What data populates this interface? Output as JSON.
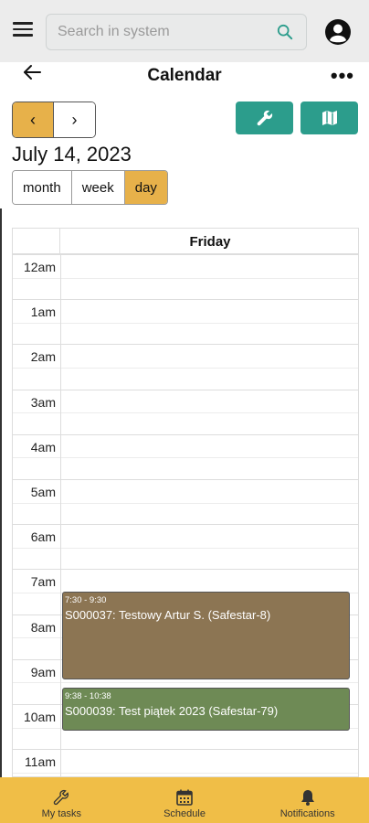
{
  "search": {
    "placeholder": "Search in system"
  },
  "page": {
    "title": "Calendar",
    "more_label": "•••"
  },
  "nav": {
    "prev_label": "‹",
    "next_label": "›"
  },
  "date_title": "July 14, 2023",
  "views": [
    {
      "label": "month",
      "active": false
    },
    {
      "label": "week",
      "active": false
    },
    {
      "label": "day",
      "active": true
    }
  ],
  "calendar": {
    "day_name": "Friday",
    "hours": [
      "12am",
      "1am",
      "2am",
      "3am",
      "4am",
      "5am",
      "6am",
      "7am",
      "8am",
      "9am",
      "10am",
      "11am"
    ],
    "events": [
      {
        "time": "7:30 - 9:30",
        "title": "S000037: Testowy Artur S. (Safestar-8)",
        "color": "#8c7553"
      },
      {
        "time": "9:38 - 10:38",
        "title": "S000039: Test piątek 2023 (Safestar-79)",
        "color": "#6e8a55"
      }
    ]
  },
  "bottom_nav": [
    {
      "label": "My tasks",
      "icon": "wrench-icon"
    },
    {
      "label": "Schedule",
      "icon": "calendar-icon"
    },
    {
      "label": "Notifications",
      "icon": "bell-icon"
    }
  ],
  "colors": {
    "accent": "#e7b14a",
    "teal": "#2c9d8c",
    "bottom_bar": "#f0be47"
  }
}
